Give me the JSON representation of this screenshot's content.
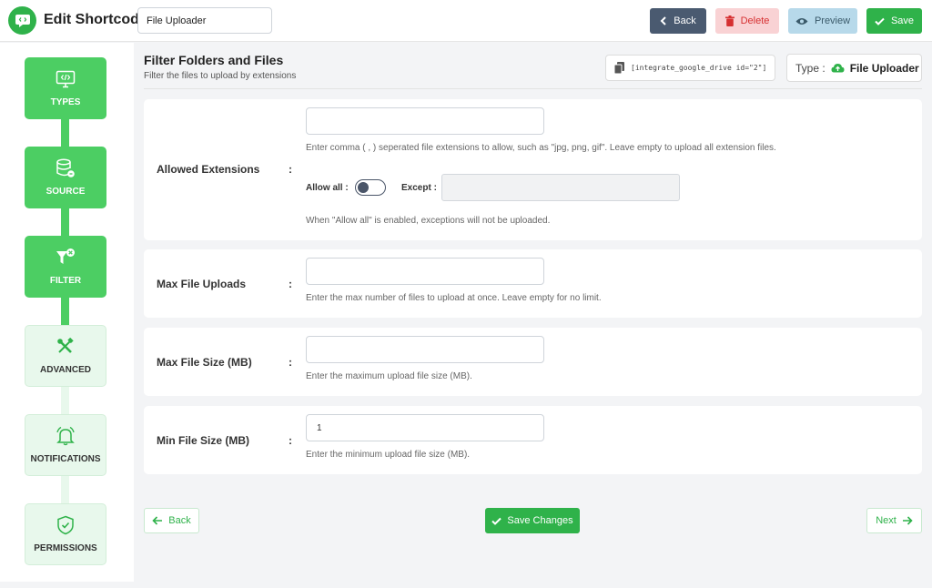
{
  "header": {
    "title": "Edit Shortcode",
    "shortcode_title_value": "File Uploader",
    "back_label": "Back",
    "delete_label": "Delete",
    "preview_label": "Preview",
    "save_label": "Save"
  },
  "sidebar": {
    "steps": [
      {
        "label": "TYPES",
        "icon": "code-monitor-icon",
        "active": true
      },
      {
        "label": "SOURCE",
        "icon": "database-icon",
        "active": true
      },
      {
        "label": "FILTER",
        "icon": "filter-icon",
        "active": true
      },
      {
        "label": "ADVANCED",
        "icon": "tools-icon",
        "active": false
      },
      {
        "label": "NOTIFICATIONS",
        "icon": "bell-icon",
        "active": false
      },
      {
        "label": "PERMISSIONS",
        "icon": "shield-check-icon",
        "active": false
      }
    ]
  },
  "main": {
    "title": "Filter Folders and Files",
    "subtitle": "Filter the files to upload by extensions",
    "shortcode": "[integrate_google_drive id=\"2\"]",
    "type_label": "Type :",
    "type_value": "File Uploader"
  },
  "fields": {
    "allowed_extensions": {
      "label": "Allowed Extensions",
      "colon": ":",
      "value": "",
      "help": "Enter comma ( , ) seperated file extensions to allow, such as \"jpg, png, gif\". Leave empty to upload all extension files.",
      "allow_all_label": "Allow all :",
      "allow_all_enabled": false,
      "except_label": "Except :",
      "except_value": "",
      "allow_all_help": "When \"Allow all\" is enabled, exceptions will not be uploaded."
    },
    "max_file_uploads": {
      "label": "Max File Uploads",
      "colon": ":",
      "value": "",
      "help": "Enter the max number of files to upload at once. Leave empty for no limit."
    },
    "max_file_size": {
      "label": "Max File Size (MB)",
      "colon": ":",
      "value": "",
      "help": "Enter the maximum upload file size (MB)."
    },
    "min_file_size": {
      "label": "Min File Size (MB)",
      "colon": ":",
      "value": "1",
      "help": "Enter the minimum upload file size (MB)."
    }
  },
  "footer": {
    "back_label": "Back",
    "save_changes_label": "Save Changes",
    "next_label": "Next"
  },
  "colors": {
    "brand_green": "#2fb24a",
    "step_active": "#4cce63",
    "step_inactive": "#e8f8ec",
    "back_button": "#4a5a70",
    "delete_button": "#f9d2d4",
    "preview_button": "#b7d9ea"
  }
}
